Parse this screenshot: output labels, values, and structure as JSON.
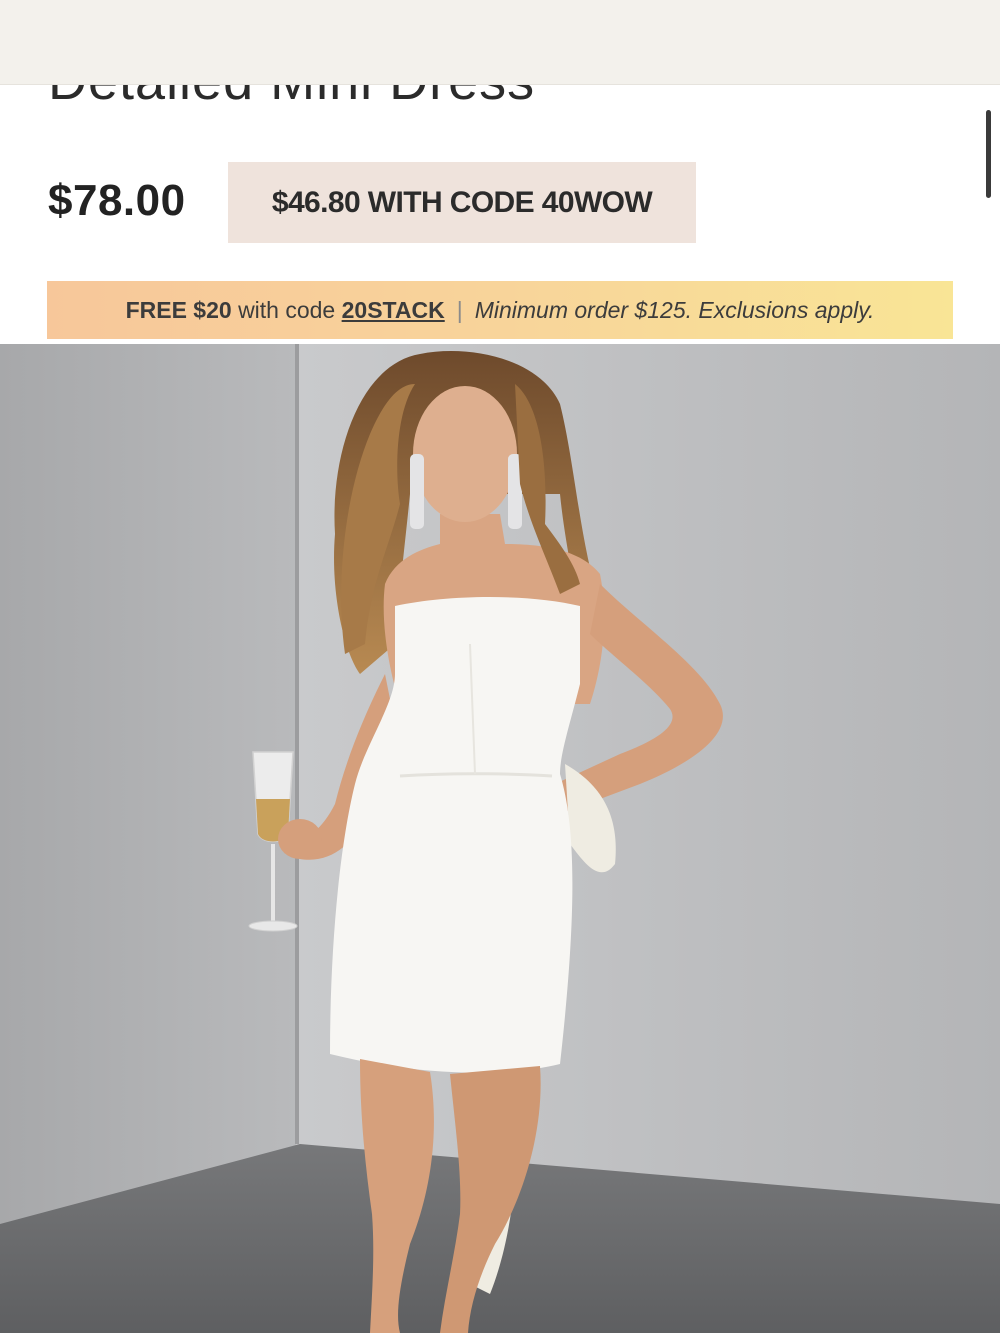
{
  "product": {
    "title": "Detailed Mini Dress",
    "price": "$78.00",
    "promo_price_text": "$46.80 WITH CODE 40WOW"
  },
  "banner": {
    "offer": "FREE $20",
    "with_code": "with code",
    "code": "20STACK",
    "separator": "|",
    "terms": "Minimum order $125. Exclusions apply."
  },
  "colors": {
    "promo_box_bg": "#efe3dc",
    "banner_gradient_start": "#f7c79a",
    "banner_gradient_end": "#f9e596"
  }
}
